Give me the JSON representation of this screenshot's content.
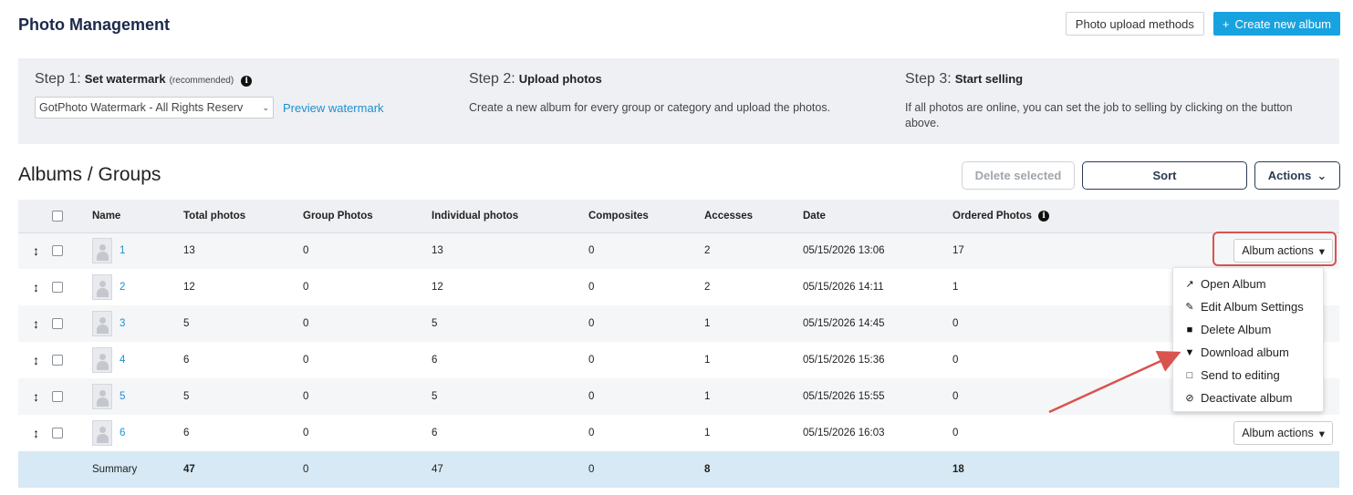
{
  "header": {
    "title": "Photo Management",
    "upload_methods_label": "Photo upload methods",
    "create_album_label": "Create new album",
    "create_album_icon": "+"
  },
  "steps": {
    "step1": {
      "prefix": "Step 1:",
      "title": "Set watermark",
      "note": "(recommended)",
      "info_icon": "i",
      "watermark_select_value": "GotPhoto Watermark - All Rights Reserv",
      "preview_link": "Preview watermark"
    },
    "step2": {
      "prefix": "Step 2:",
      "title": "Upload photos",
      "text": "Create a new album for every group or category and upload the photos."
    },
    "step3": {
      "prefix": "Step 3:",
      "title": "Start selling",
      "text": "If all photos are online, you can set the job to selling by clicking on the button above."
    }
  },
  "albums": {
    "title": "Albums / Groups",
    "delete_selected_label": "Delete selected",
    "sort_label": "Sort",
    "actions_label": "Actions",
    "columns": {
      "name": "Name",
      "total": "Total photos",
      "group": "Group Photos",
      "individual": "Individual photos",
      "composites": "Composites",
      "accesses": "Accesses",
      "date": "Date",
      "ordered": "Ordered Photos"
    },
    "rows": [
      {
        "name": "1",
        "total": "13",
        "group": "0",
        "individual": "13",
        "composites": "0",
        "accesses": "2",
        "date": "05/15/2026 13:06",
        "ordered": "17",
        "action": "Album actions"
      },
      {
        "name": "2",
        "total": "12",
        "group": "0",
        "individual": "12",
        "composites": "0",
        "accesses": "2",
        "date": "05/15/2026 14:11",
        "ordered": "1",
        "action": ""
      },
      {
        "name": "3",
        "total": "5",
        "group": "0",
        "individual": "5",
        "composites": "0",
        "accesses": "1",
        "date": "05/15/2026 14:45",
        "ordered": "0",
        "action": ""
      },
      {
        "name": "4",
        "total": "6",
        "group": "0",
        "individual": "6",
        "composites": "0",
        "accesses": "1",
        "date": "05/15/2026 15:36",
        "ordered": "0",
        "action": ""
      },
      {
        "name": "5",
        "total": "5",
        "group": "0",
        "individual": "5",
        "composites": "0",
        "accesses": "1",
        "date": "05/15/2026 15:55",
        "ordered": "0",
        "action": ""
      },
      {
        "name": "6",
        "total": "6",
        "group": "0",
        "individual": "6",
        "composites": "0",
        "accesses": "1",
        "date": "05/15/2026 16:03",
        "ordered": "0",
        "action": "Album actions"
      }
    ],
    "summary": {
      "label": "Summary",
      "total": "47",
      "group": "0",
      "individual": "47",
      "composites": "0",
      "accesses": "8",
      "ordered": "18"
    }
  },
  "dropdown": {
    "items": [
      {
        "label": "Open Album",
        "icon": "external-link-icon"
      },
      {
        "label": "Edit Album Settings",
        "icon": "pencil-icon"
      },
      {
        "label": "Delete Album",
        "icon": "trash-icon"
      },
      {
        "label": "Download album",
        "icon": "download-file-icon"
      },
      {
        "label": "Send to editing",
        "icon": "edit-square-icon"
      },
      {
        "label": "Deactivate album",
        "icon": "ban-icon"
      }
    ]
  },
  "colors": {
    "primary": "#18a3e0",
    "link": "#1d8fd1",
    "highlight": "#d9534f",
    "summary_bg": "#d6e9f4"
  }
}
